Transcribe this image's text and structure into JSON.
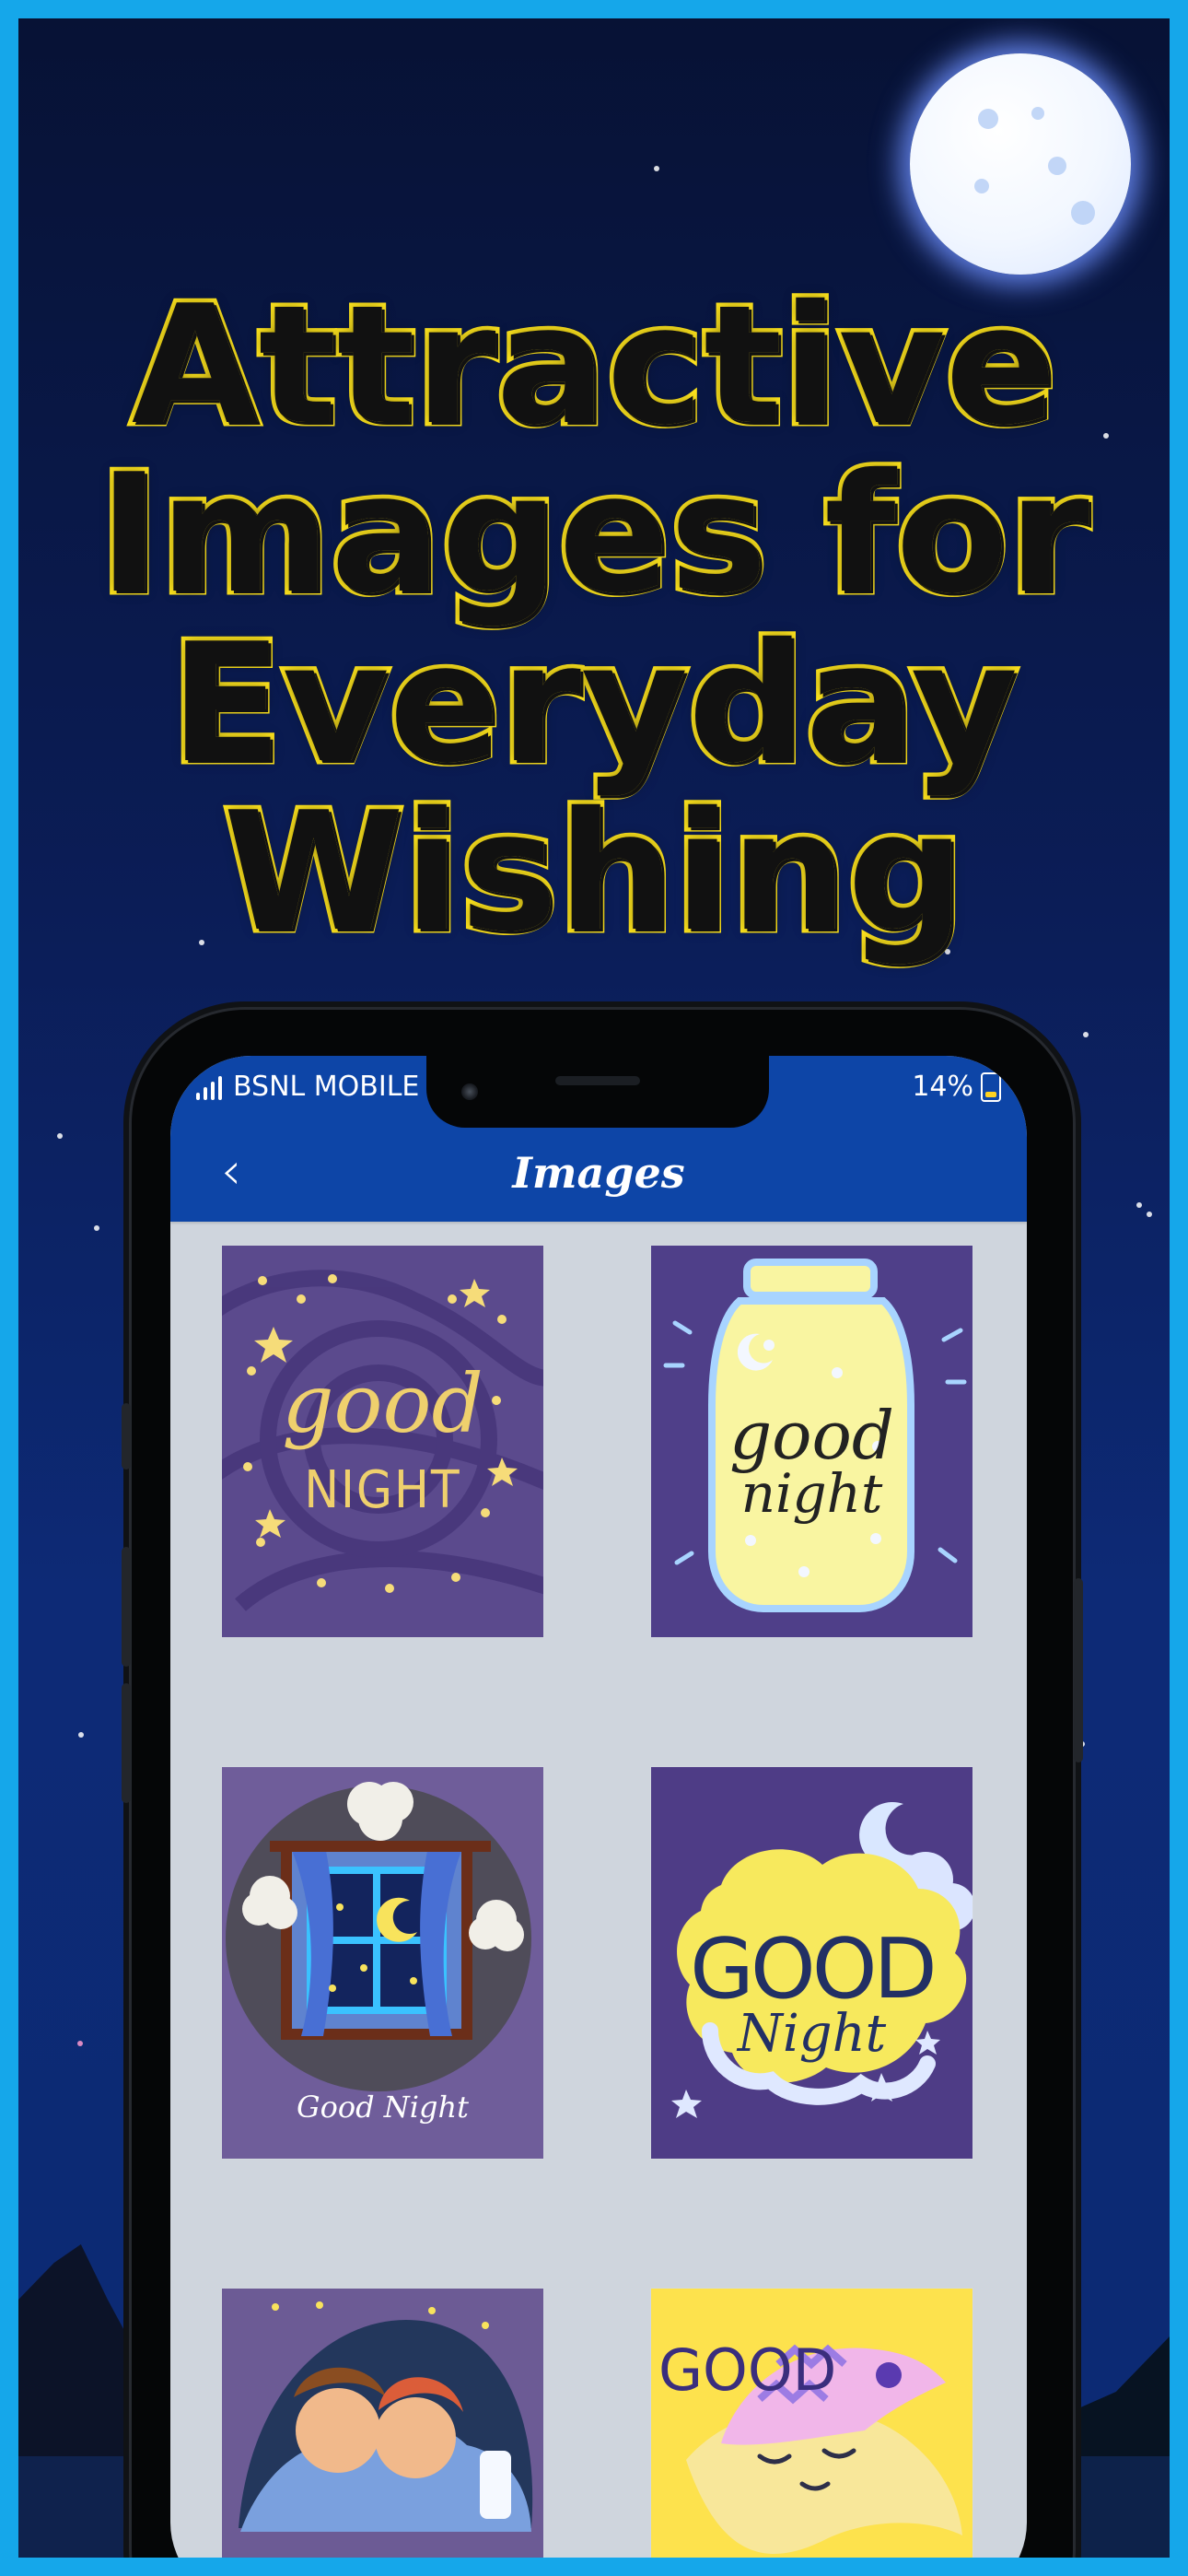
{
  "headline": {
    "line1": "Attractive",
    "line2": "Images for",
    "line3": "Everyday",
    "line4": "Wishing"
  },
  "status_bar": {
    "carrier": "BSNL MOBILE",
    "battery": "14%"
  },
  "header": {
    "title": "Images"
  },
  "cards": [
    {
      "top_text": "good",
      "bottom_text": "NIGHT"
    },
    {
      "top_text": "good",
      "bottom_text": "night"
    },
    {
      "bottom_text": "Good Night"
    },
    {
      "top_text": "GOOD",
      "bottom_text": "Night"
    },
    {},
    {
      "top_text": "GOOD"
    }
  ],
  "icons": {
    "back": "chevron-left-icon",
    "signal": "signal-icon",
    "battery": "battery-icon",
    "moon": "moon-icon"
  },
  "colors": {
    "border": "#15a7ea",
    "header": "#0d45a7",
    "headline_fill": "#111111",
    "headline_stroke": "#ffe51d"
  }
}
